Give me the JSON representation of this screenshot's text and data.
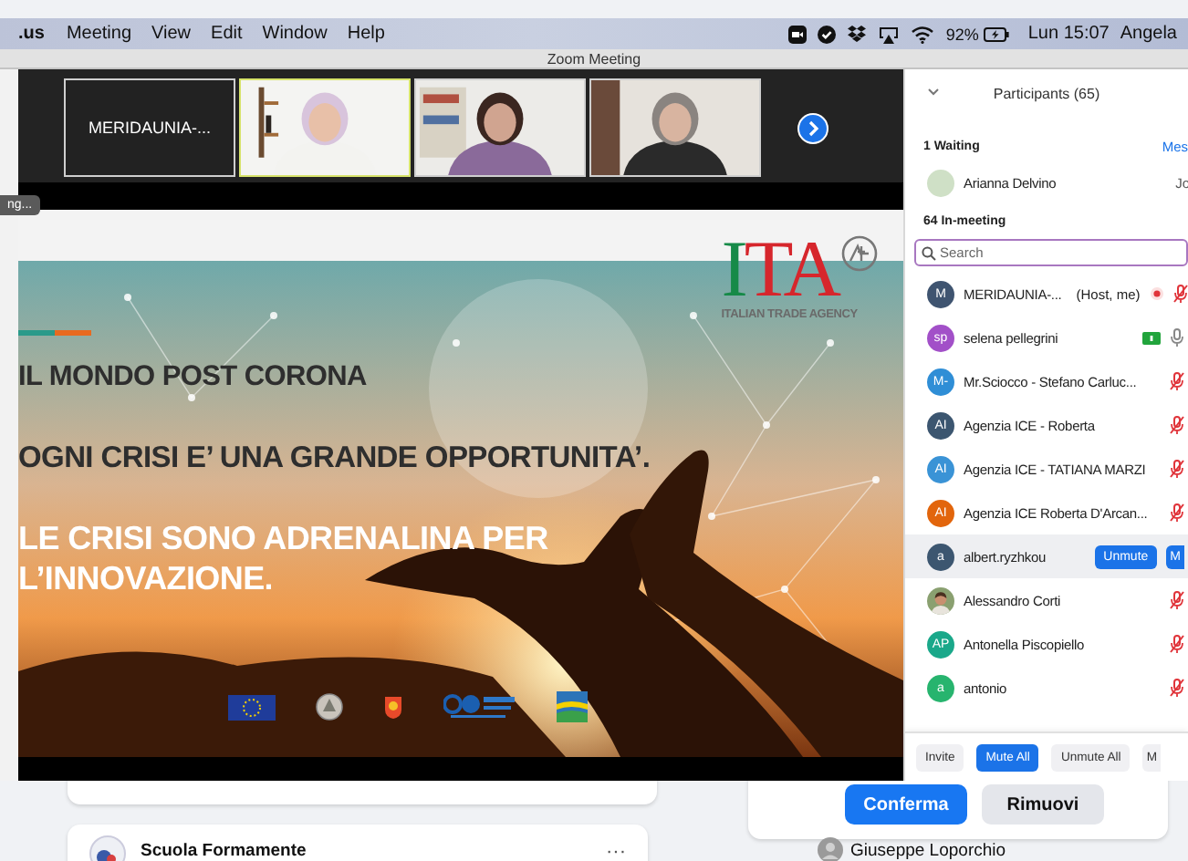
{
  "menu_bar": {
    "app": ".us",
    "menus": [
      "Meeting",
      "View",
      "Edit",
      "Window",
      "Help"
    ],
    "battery": "92%",
    "clock": "Lun 15:07",
    "user": "Angela"
  },
  "window": {
    "title": "Zoom Meeting"
  },
  "gallery": {
    "tiles": [
      {
        "kind": "name",
        "label": "MERIDAUNIA-...",
        "speaking": false
      },
      {
        "kind": "video",
        "speaking": true
      },
      {
        "kind": "video",
        "speaking": false
      },
      {
        "kind": "video",
        "speaking": false
      }
    ]
  },
  "tooltip": "ng...",
  "slide": {
    "logo": {
      "name": "ITA",
      "subtitle": "ITALIAN TRADE AGENCY"
    },
    "lines": [
      {
        "text": "IL MONDO POST CORONA",
        "kind": "dark"
      },
      {
        "text": "OGNI CRISI E’ UNA GRANDE OPPORTUNITA’.",
        "kind": "dark"
      },
      {
        "text": "LE CRISI SONO ADRENALINA PER",
        "kind": "light"
      },
      {
        "text": "L’INNOVAZIONE.",
        "kind": "light"
      }
    ]
  },
  "participants": {
    "title": "Participants (65)",
    "waiting_heading": "1 Waiting",
    "message_link": "Mes",
    "waiting": [
      {
        "name": "Arianna Delvino",
        "action": "Jo",
        "color": "#cfe0c6"
      }
    ],
    "in_meeting_heading": "64 In-meeting",
    "search": {
      "placeholder": "Search"
    },
    "list": [
      {
        "kind": "initials",
        "initials": "M",
        "color": "#3f5470",
        "name": "MERIDAUNIA-...",
        "note": "(Host, me)",
        "recording": true,
        "video": false,
        "muted": true,
        "selected": false
      },
      {
        "kind": "initials",
        "initials": "sp",
        "color": "#a250c8",
        "name": "selena pellegrini",
        "recording": false,
        "video": true,
        "muted": false,
        "selected": false
      },
      {
        "kind": "initials",
        "initials": "M-",
        "color": "#2f8ed6",
        "name": "Mr.Sciocco - Stefano Carluc...",
        "recording": false,
        "video": false,
        "muted": true,
        "selected": false
      },
      {
        "kind": "initials",
        "initials": "AI",
        "color": "#3c5670",
        "name": "Agenzia ICE - Roberta",
        "recording": false,
        "video": false,
        "muted": true,
        "selected": false
      },
      {
        "kind": "initials",
        "initials": "AI",
        "color": "#3a93d6",
        "name": "Agenzia ICE - TATIANA MARZI",
        "recording": false,
        "video": false,
        "muted": true,
        "selected": false
      },
      {
        "kind": "initials",
        "initials": "AI",
        "color": "#e2650c",
        "name": "Agenzia ICE Roberta D'Arcan...",
        "recording": false,
        "video": false,
        "muted": true,
        "selected": false
      },
      {
        "kind": "initials",
        "initials": "a",
        "color": "#3c5670",
        "name": "albert.ryzhkou",
        "recording": false,
        "video": false,
        "selected": true,
        "actions": [
          {
            "label": "Unmute"
          },
          {
            "label": "M"
          }
        ]
      },
      {
        "name": "Alessandro Corti",
        "recording": false,
        "video": false,
        "muted": true,
        "selected": false
      },
      {
        "kind": "initials",
        "initials": "AP",
        "color": "#1aa88a",
        "name": "Antonella Piscopiello",
        "recording": false,
        "video": false,
        "muted": true,
        "selected": false
      },
      {
        "kind": "initials",
        "initials": "a",
        "color": "#27b46e",
        "name": "antonio",
        "recording": false,
        "video": false,
        "muted": true,
        "selected": false
      }
    ],
    "footer_buttons": [
      {
        "label": "Invite",
        "primary": false
      },
      {
        "label": "Mute All",
        "primary": true
      },
      {
        "label": "Unmute All",
        "primary": false
      },
      {
        "label": "M",
        "primary": false
      }
    ]
  },
  "background_page": {
    "post_author": "Scuola Formamente",
    "more": "···",
    "dialog_buttons": [
      {
        "label": "Conferma",
        "primary": true
      },
      {
        "label": "Rimuovi",
        "primary": false
      }
    ],
    "contact": "Giuseppe Loporchio"
  }
}
